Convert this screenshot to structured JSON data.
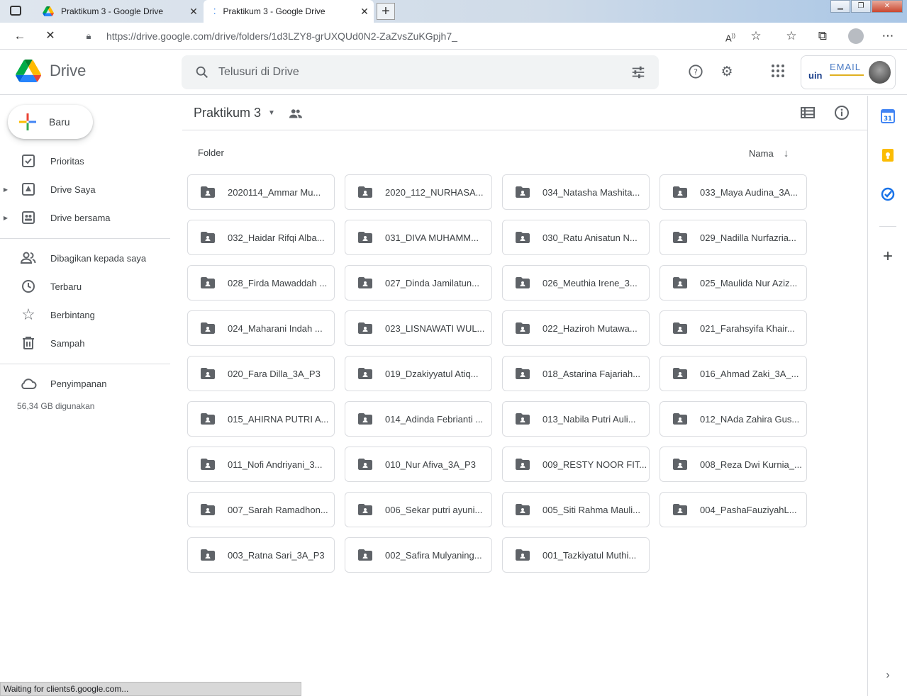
{
  "browser": {
    "tabs": [
      {
        "title": "Praktikum 3 - Google Drive",
        "active": false
      },
      {
        "title": "Praktikum 3 - Google Drive",
        "active": true
      }
    ],
    "url": "https://drive.google.com/drive/folders/1d3LZY8-grUXQUd0N2-ZaZvsZuKGpjh7_",
    "status_text": "Waiting for clients6.google.com..."
  },
  "header": {
    "app_name": "Drive",
    "search_placeholder": "Telusuri di Drive",
    "account_badge_text": "EMAIL",
    "account_logo_text": "uin"
  },
  "sidebar": {
    "new_label": "Baru",
    "items": [
      {
        "label": "Prioritas",
        "icon": "check-box-icon"
      },
      {
        "label": "Drive Saya",
        "icon": "my-drive-icon"
      },
      {
        "label": "Drive bersama",
        "icon": "shared-drives-icon"
      },
      {
        "label": "Dibagikan kepada saya",
        "icon": "people-icon"
      },
      {
        "label": "Terbaru",
        "icon": "clock-icon"
      },
      {
        "label": "Berbintang",
        "icon": "star-icon"
      },
      {
        "label": "Sampah",
        "icon": "trash-icon"
      }
    ],
    "storage_label": "Penyimpanan",
    "storage_used": "56,34 GB digunakan"
  },
  "main": {
    "breadcrumb": "Praktikum 3",
    "section_label": "Folder",
    "sort_label": "Nama",
    "folders": [
      "2020114_Ammar Mu...",
      "2020_112_NURHASA...",
      "034_Natasha Mashita...",
      "033_Maya Audina_3A...",
      "032_Haidar Rifqi Alba...",
      "031_DIVA MUHAMM...",
      "030_Ratu Anisatun N...",
      "029_Nadilla Nurfazria...",
      "028_Firda Mawaddah ...",
      "027_Dinda Jamilatun...",
      "026_Meuthia Irene_3...",
      "025_Maulida Nur Aziz...",
      "024_Maharani Indah ...",
      "023_LISNAWATI WUL...",
      "022_Haziroh Mutawa...",
      "021_Farahsyifa Khair...",
      "020_Fara Dilla_3A_P3",
      "019_Dzakiyyatul Atiq...",
      "018_Astarina Fajariah...",
      "016_Ahmad Zaki_3A_...",
      "015_AHIRNA PUTRI A...",
      "014_Adinda Febrianti ...",
      "013_Nabila Putri Auli...",
      "012_NAda Zahira Gus...",
      "011_Nofi Andriyani_3...",
      "010_Nur Afiva_3A_P3",
      "009_RESTY NOOR FIT...",
      "008_Reza Dwi Kurnia_...",
      "007_Sarah Ramadhon...",
      "006_Sekar putri ayuni...",
      "005_Siti Rahma Mauli...",
      "004_PashaFauziyahL...",
      "003_Ratna Sari_3A_P3",
      "002_Safira Mulyaning...",
      "001_Tazkiyatul Muthi..."
    ]
  },
  "rightbar": {
    "calendar_day": "31"
  },
  "colors": {
    "blue": "#1a73e8",
    "icon_grey": "#5f6368",
    "border": "#dadce0",
    "keep_yellow": "#fbbc04"
  }
}
